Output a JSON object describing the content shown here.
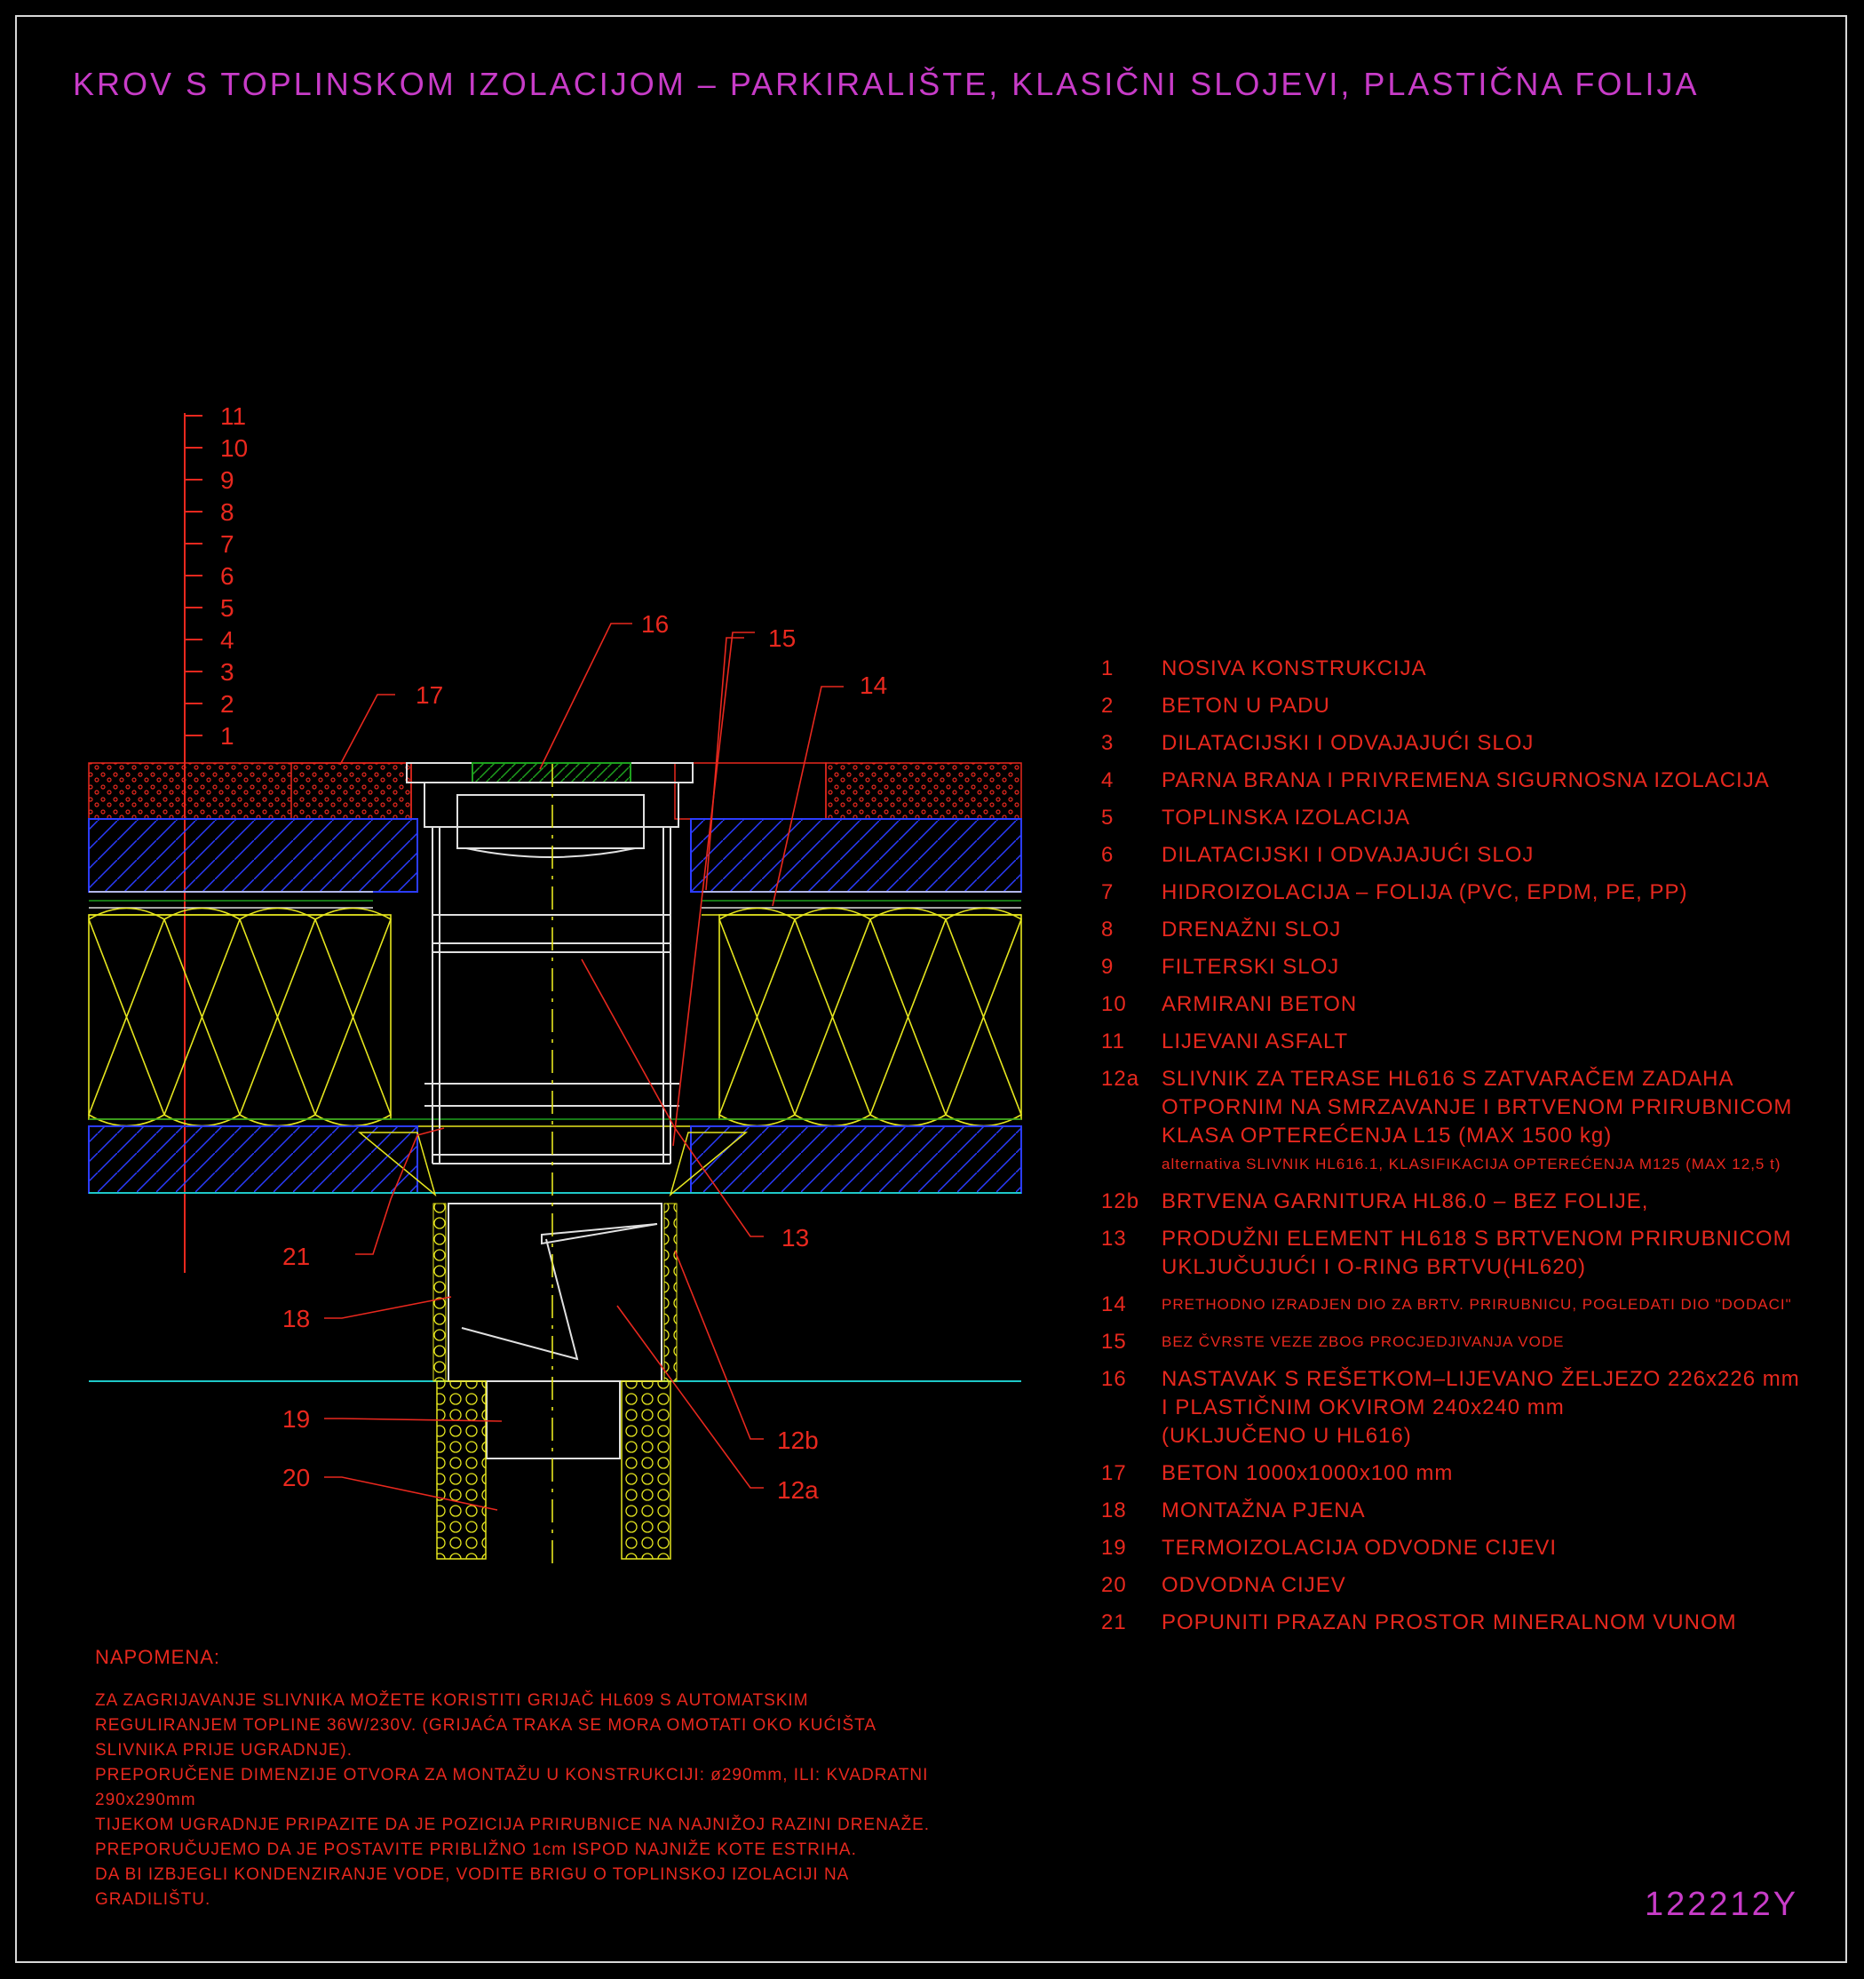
{
  "title": "KROV S TOPLINSKOM IZOLACIJOM – PARKIRALIŠTE, KLASIČNI SLOJEVI, PLASTIČNA FOLIJA",
  "drawing_code": "122212Y",
  "colors": {
    "title": "#c83cc8",
    "text": "#e8281e",
    "insulation": "#e6e61e",
    "concrete": "#2b3cff",
    "pipe": "#e0e0e0",
    "hatch": "#1ea01e",
    "water": "#1ec8c8"
  },
  "layer_scale": [
    "11",
    "10",
    "9",
    "8",
    "7",
    "6",
    "5",
    "4",
    "3",
    "2",
    "1"
  ],
  "callouts": {
    "c16": "16",
    "c15": "15",
    "c14": "14",
    "c17": "17",
    "c13": "13",
    "c21": "21",
    "c18": "18",
    "c19": "19",
    "c20": "20",
    "c12b": "12b",
    "c12a": "12a"
  },
  "legend": [
    {
      "num": "1",
      "text": "NOSIVA KONSTRUKCIJA"
    },
    {
      "num": "2",
      "text": "BETON U PADU"
    },
    {
      "num": "3",
      "text": "DILATACIJSKI I ODVAJAJUĆI SLOJ"
    },
    {
      "num": "4",
      "text": "PARNA BRANA I PRIVREMENA SIGURNOSNA IZOLACIJA"
    },
    {
      "num": "5",
      "text": "TOPLINSKA IZOLACIJA"
    },
    {
      "num": "6",
      "text": "DILATACIJSKI I ODVAJAJUĆI SLOJ"
    },
    {
      "num": "7",
      "text": "HIDROIZOLACIJA – FOLIJA (PVC, EPDM, PE, PP)"
    },
    {
      "num": "8",
      "text": "DRENAŽNI SLOJ"
    },
    {
      "num": "9",
      "text": "FILTERSKI SLOJ"
    },
    {
      "num": "10",
      "text": "ARMIRANI BETON"
    },
    {
      "num": "11",
      "text": "LIJEVANI ASFALT"
    },
    {
      "num": "12a",
      "text": "SLIVNIK ZA TERASE HL616 S ZATVARAČEM ZADAHA"
    },
    {
      "num": "",
      "text": "OTPORNIM NA SMRZAVANJE I BRTVENOM PRIRUBNICOM"
    },
    {
      "num": "",
      "text": "KLASA OPTEREĆENJA L15 (MAX 1500 kg)"
    },
    {
      "num": "",
      "text": "alternativa SLIVNIK HL616.1, KLASIFIKACIJA OPTEREĆENJA M125 (MAX 12,5 t)",
      "small": true
    },
    {
      "num": "12b",
      "text": "BRTVENA GARNITURA HL86.0 – BEZ FOLIJE,"
    },
    {
      "num": "13",
      "text": "PRODUŽNI ELEMENT HL618 S BRTVENOM PRIRUBNICOM"
    },
    {
      "num": "",
      "text": "UKLJUČUJUĆI I O-RING BRTVU(HL620)"
    },
    {
      "num": "14",
      "text": "PRETHODNO IZRADJEN DIO ZA BRTV. PRIRUBNICU, POGLEDATI DIO \"DODACI\"",
      "small": true
    },
    {
      "num": "15",
      "text": "BEZ ČVRSTE VEZE ZBOG PROCJEDJIVANJA VODE",
      "small": true
    },
    {
      "num": "16",
      "text": "NASTAVAK S REŠETKOM–LIJEVANO ŽELJEZO 226x226 mm"
    },
    {
      "num": "",
      "text": "I PLASTIČNIM OKVIROM 240x240 mm"
    },
    {
      "num": "",
      "text": "(UKLJUČENO U HL616)"
    },
    {
      "num": "17",
      "text": "BETON 1000x1000x100 mm"
    },
    {
      "num": "18",
      "text": "MONTAŽNA PJENA"
    },
    {
      "num": "19",
      "text": "TERMOIZOLACIJA ODVODNE CIJEVI"
    },
    {
      "num": "20",
      "text": "ODVODNA CIJEV"
    },
    {
      "num": "21",
      "text": "POPUNITI PRAZAN PROSTOR MINERALNOM VUNOM"
    }
  ],
  "notes": {
    "heading": "NAPOMENA:",
    "lines": [
      "ZA ZAGRIJAVANJE SLIVNIKA MOŽETE KORISTITI GRIJAČ HL609 S AUTOMATSKIM",
      "REGULIRANJEM TOPLINE 36W/230V. (GRIJAĆA TRAKA SE MORA OMOTATI OKO KUĆIŠTA",
      "SLIVNIKA PRIJE UGRADNJE).",
      "PREPORUČENE DIMENZIJE OTVORA ZA MONTAŽU U KONSTRUKCIJI: ø290mm, ILI: KVADRATNI",
      "290x290mm",
      "TIJEKOM UGRADNJE PRIPAZITE DA JE POZICIJA PRIRUBNICE NA NAJNIŽOJ RAZINI DRENAŽE.",
      "PREPORUČUJEMO DA JE POSTAVITE PRIBLIŽNO 1cm ISPOD NAJNIŽE KOTE ESTRIHA.",
      "DA BI IZBJEGLI KONDENZIRANJE VODE, VODITE BRIGU O TOPLINSKOJ IZOLACIJI NA",
      "GRADILIŠTU."
    ]
  }
}
